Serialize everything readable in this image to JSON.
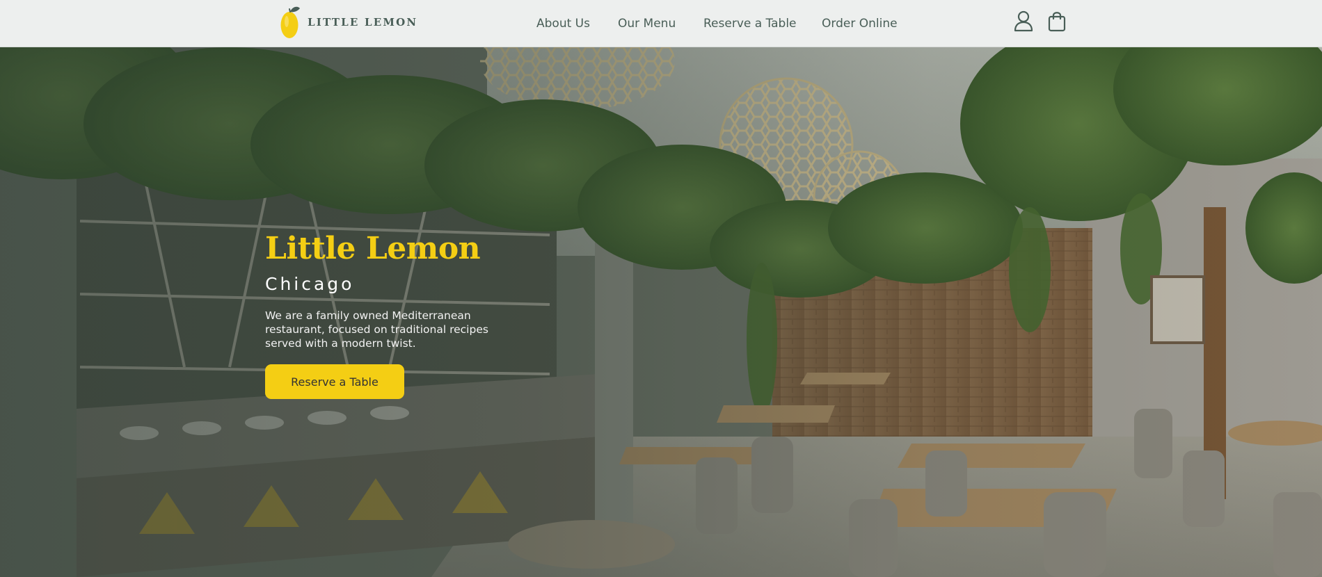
{
  "brand": {
    "name": "LITTLE LEMON",
    "colors": {
      "primary_green": "#495e57",
      "primary_yellow": "#f4ce14",
      "header_bg": "#edefee"
    }
  },
  "nav": {
    "items": [
      {
        "label": "About Us"
      },
      {
        "label": "Our Menu"
      },
      {
        "label": "Reserve a Table"
      },
      {
        "label": "Order Online"
      }
    ],
    "icons": [
      "user-icon",
      "shopping-bag-icon"
    ]
  },
  "hero": {
    "title": "Little Lemon",
    "subtitle": "Chicago",
    "description": "We are a family owned Mediterranean restaurant, focused on traditional recipes served with a modern twist.",
    "cta_label": "Reserve a Table"
  }
}
